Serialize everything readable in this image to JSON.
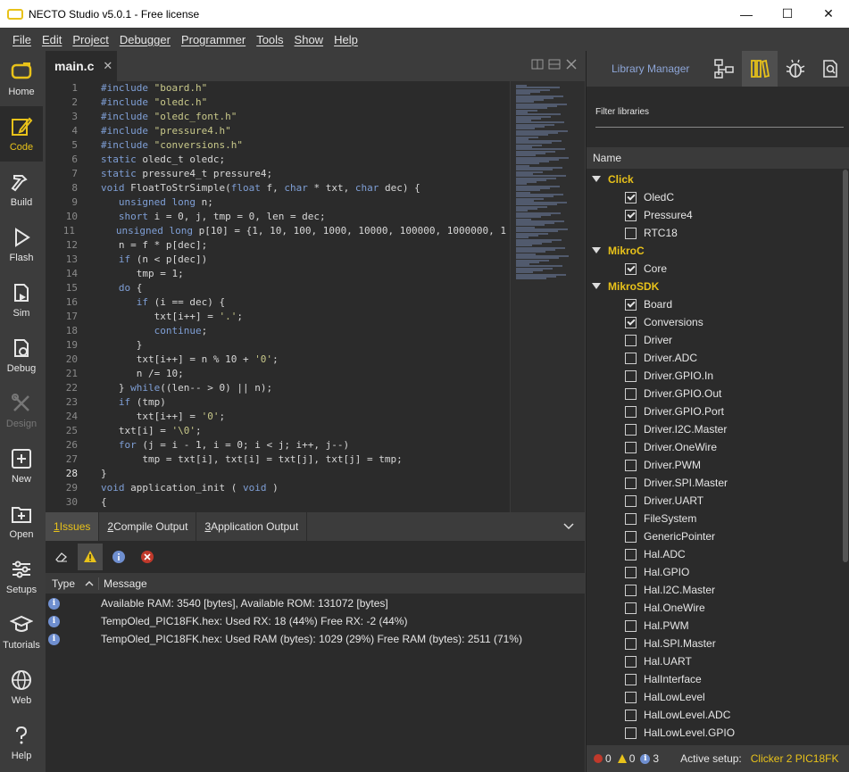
{
  "window": {
    "title": "NECTO Studio v5.0.1 - Free license",
    "minimize": "—",
    "maximize": "☐",
    "close": "✕"
  },
  "menu": [
    "File",
    "Edit",
    "Project",
    "Debugger",
    "Programmer",
    "Tools",
    "Show",
    "Help"
  ],
  "sidebar": [
    {
      "label": "Home",
      "icon": "home-icon"
    },
    {
      "label": "Code",
      "icon": "pencil-icon",
      "active": true
    },
    {
      "label": "Build",
      "icon": "hammer-icon"
    },
    {
      "label": "Flash",
      "icon": "play-icon"
    },
    {
      "label": "Sim",
      "icon": "sim-icon"
    },
    {
      "label": "Debug",
      "icon": "debug-icon"
    },
    {
      "label": "Design",
      "icon": "design-icon",
      "disabled": true
    },
    {
      "label": "New",
      "icon": "plus-icon"
    },
    {
      "label": "Open",
      "icon": "folder-icon"
    },
    {
      "label": "Setups",
      "icon": "sliders-icon"
    },
    {
      "label": "Tutorials",
      "icon": "graduation-icon"
    },
    {
      "label": "Web",
      "icon": "globe-icon"
    },
    {
      "label": "Help",
      "icon": "question-icon"
    }
  ],
  "editor": {
    "tab": "main.c",
    "tab_close": "✕",
    "lines": [
      {
        "n": "1",
        "text": "#include \"board.h\""
      },
      {
        "n": "2",
        "text": "#include \"oledc.h\""
      },
      {
        "n": "3",
        "text": "#include \"oledc_font.h\""
      },
      {
        "n": "4",
        "text": "#include \"pressure4.h\""
      },
      {
        "n": "5",
        "text": "#include \"conversions.h\""
      },
      {
        "n": "6",
        "text": "static oledc_t oledc;"
      },
      {
        "n": "7",
        "text": "static pressure4_t pressure4;"
      },
      {
        "n": "8",
        "text": "void FloatToStrSimple(float f, char * txt, char dec) {"
      },
      {
        "n": "9",
        "text": "   unsigned long n;"
      },
      {
        "n": "10",
        "text": "   short i = 0, j, tmp = 0, len = dec;"
      },
      {
        "n": "11",
        "text": "   unsigned long p[10] = {1, 10, 100, 1000, 10000, 100000, 1000000, 1"
      },
      {
        "n": "12",
        "text": "   n = f * p[dec];"
      },
      {
        "n": "13",
        "text": "   if (n < p[dec])"
      },
      {
        "n": "14",
        "text": "      tmp = 1;"
      },
      {
        "n": "15",
        "text": "   do {"
      },
      {
        "n": "16",
        "text": "      if (i == dec) {"
      },
      {
        "n": "17",
        "text": "         txt[i++] = '.';"
      },
      {
        "n": "18",
        "text": "         continue;"
      },
      {
        "n": "19",
        "text": "      }"
      },
      {
        "n": "20",
        "text": "      txt[i++] = n % 10 + '0';"
      },
      {
        "n": "21",
        "text": "      n /= 10;"
      },
      {
        "n": "22",
        "text": "   } while((len-- > 0) || n);"
      },
      {
        "n": "23",
        "text": "   if (tmp)"
      },
      {
        "n": "24",
        "text": "      txt[i++] = '0';"
      },
      {
        "n": "25",
        "text": "   txt[i] = '\\0';"
      },
      {
        "n": "26",
        "text": "   for (j = i - 1, i = 0; i < j; i++, j--)"
      },
      {
        "n": "27",
        "text": "       tmp = txt[i], txt[i] = txt[j], txt[j] = tmp;"
      },
      {
        "n": "28",
        "text": "}"
      },
      {
        "n": "29",
        "text": "void application_init ( void )"
      },
      {
        "n": "30",
        "text": "{"
      }
    ]
  },
  "bottom": {
    "tabs": [
      {
        "num": "1",
        "label": " Issues"
      },
      {
        "num": "2",
        "label": " Compile Output"
      },
      {
        "num": "3",
        "label": " Application Output"
      }
    ],
    "header": {
      "type": "Type",
      "message": "Message"
    },
    "rows": [
      "Available RAM: 3540 [bytes], Available ROM: 131072 [bytes]",
      "TempOled_PIC18FK.hex: Used RX: 18 (44%)  Free RX: -2 (44%)",
      "TempOled_PIC18FK.hex: Used RAM (bytes): 1029 (29%)  Free RAM (bytes): 2511 (71%)"
    ]
  },
  "library": {
    "title": "Library Manager",
    "filter_placeholder": "Filter libraries",
    "name_header": "Name",
    "groups": [
      {
        "name": "Click",
        "items": [
          {
            "label": "OledC",
            "checked": true
          },
          {
            "label": "Pressure4",
            "checked": true
          },
          {
            "label": "RTC18",
            "checked": false
          }
        ]
      },
      {
        "name": "MikroC",
        "items": [
          {
            "label": "Core",
            "checked": true
          }
        ]
      },
      {
        "name": "MikroSDK",
        "items": [
          {
            "label": "Board",
            "checked": true
          },
          {
            "label": "Conversions",
            "checked": true
          },
          {
            "label": "Driver",
            "checked": false
          },
          {
            "label": "Driver.ADC",
            "checked": false
          },
          {
            "label": "Driver.GPIO.In",
            "checked": false
          },
          {
            "label": "Driver.GPIO.Out",
            "checked": false
          },
          {
            "label": "Driver.GPIO.Port",
            "checked": false
          },
          {
            "label": "Driver.I2C.Master",
            "checked": false
          },
          {
            "label": "Driver.OneWire",
            "checked": false
          },
          {
            "label": "Driver.PWM",
            "checked": false
          },
          {
            "label": "Driver.SPI.Master",
            "checked": false
          },
          {
            "label": "Driver.UART",
            "checked": false
          },
          {
            "label": "FileSystem",
            "checked": false
          },
          {
            "label": "GenericPointer",
            "checked": false
          },
          {
            "label": "Hal.ADC",
            "checked": false
          },
          {
            "label": "Hal.GPIO",
            "checked": false
          },
          {
            "label": "Hal.I2C.Master",
            "checked": false
          },
          {
            "label": "Hal.OneWire",
            "checked": false
          },
          {
            "label": "Hal.PWM",
            "checked": false
          },
          {
            "label": "Hal.SPI.Master",
            "checked": false
          },
          {
            "label": "Hal.UART",
            "checked": false
          },
          {
            "label": "HalInterface",
            "checked": false
          },
          {
            "label": "HalLowLevel",
            "checked": false
          },
          {
            "label": "HalLowLevel.ADC",
            "checked": false
          },
          {
            "label": "HalLowLevel.GPIO",
            "checked": false
          }
        ]
      }
    ]
  },
  "status": {
    "errors": "0",
    "warnings": "0",
    "infos": "3",
    "setup_label": "Active setup:",
    "setup_value": "Clicker 2 PIC18FK"
  },
  "colors": {
    "accent": "#e8c21a",
    "info": "#6f8fd0",
    "error": "#c0392b"
  }
}
